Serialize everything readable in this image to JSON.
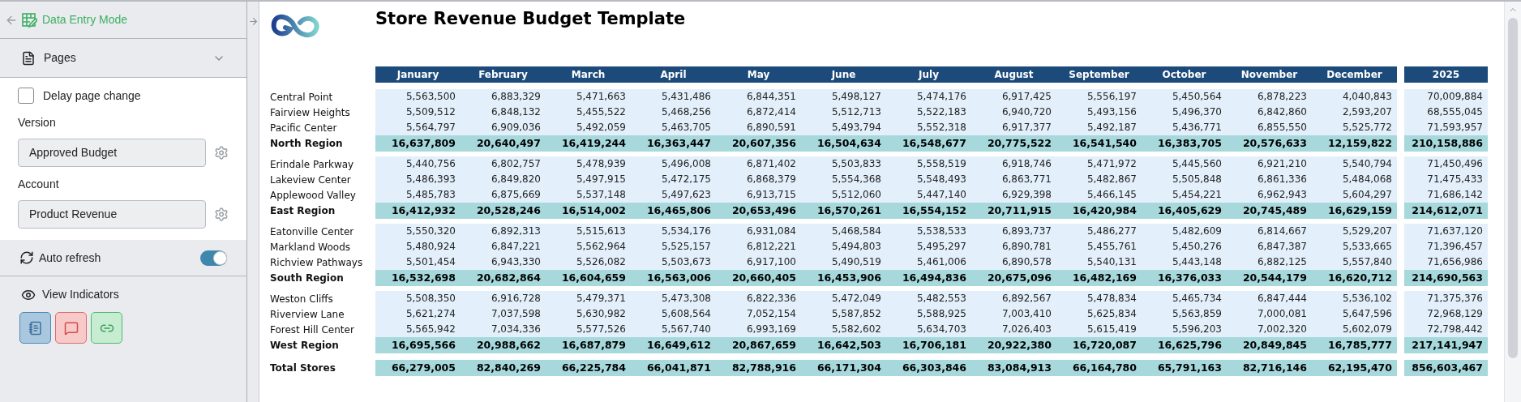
{
  "sidebar": {
    "mode": "Data Entry Mode",
    "pages": {
      "label": "Pages",
      "expanded": false
    },
    "delay": {
      "label": "Delay page change",
      "checked": false
    },
    "fields": [
      {
        "label": "Version",
        "value": "Approved Budget"
      },
      {
        "label": "Account",
        "value": "Product Revenue"
      }
    ],
    "auto_refresh": {
      "label": "Auto refresh",
      "on": true
    },
    "indicators": {
      "label": "View Indicators",
      "buttons": [
        {
          "kind": "notes"
        },
        {
          "kind": "comments"
        },
        {
          "kind": "links"
        }
      ]
    }
  },
  "report": {
    "title": "Store Revenue Budget Template",
    "columns": [
      "January",
      "February",
      "March",
      "April",
      "May",
      "June",
      "July",
      "August",
      "September",
      "October",
      "November",
      "December",
      "2025"
    ],
    "groups": [
      {
        "rows": [
          {
            "label": "Central Point",
            "cells": [
              "5,563,500",
              "6,883,329",
              "5,471,663",
              "5,431,486",
              "6,844,351",
              "5,498,127",
              "5,474,176",
              "6,917,425",
              "5,556,197",
              "5,450,564",
              "6,878,223",
              "4,040,843",
              "70,009,884"
            ]
          },
          {
            "label": "Fairview Heights",
            "cells": [
              "5,509,512",
              "6,848,132",
              "5,455,522",
              "5,468,256",
              "6,872,414",
              "5,512,713",
              "5,522,183",
              "6,940,720",
              "5,493,156",
              "5,496,370",
              "6,842,860",
              "2,593,207",
              "68,555,045"
            ]
          },
          {
            "label": "Pacific Center",
            "cells": [
              "5,564,797",
              "6,909,036",
              "5,492,059",
              "5,463,705",
              "6,890,591",
              "5,493,794",
              "5,552,318",
              "6,917,377",
              "5,492,187",
              "5,436,771",
              "6,855,550",
              "5,525,772",
              "71,593,957"
            ]
          }
        ],
        "subtotal": {
          "label": "North Region",
          "cells": [
            "16,637,809",
            "20,640,497",
            "16,419,244",
            "16,363,447",
            "20,607,356",
            "16,504,634",
            "16,548,677",
            "20,775,522",
            "16,541,540",
            "16,383,705",
            "20,576,633",
            "12,159,822",
            "210,158,886"
          ]
        }
      },
      {
        "rows": [
          {
            "label": "Erindale Parkway",
            "cells": [
              "5,440,756",
              "6,802,757",
              "5,478,939",
              "5,496,008",
              "6,871,402",
              "5,503,833",
              "5,558,519",
              "6,918,746",
              "5,471,972",
              "5,445,560",
              "6,921,210",
              "5,540,794",
              "71,450,496"
            ]
          },
          {
            "label": "Lakeview Center",
            "cells": [
              "5,486,393",
              "6,849,820",
              "5,497,915",
              "5,472,175",
              "6,868,379",
              "5,554,368",
              "5,548,493",
              "6,863,771",
              "5,482,867",
              "5,505,848",
              "6,861,336",
              "5,484,068",
              "71,475,433"
            ]
          },
          {
            "label": "Applewood Valley",
            "cells": [
              "5,485,783",
              "6,875,669",
              "5,537,148",
              "5,497,623",
              "6,913,715",
              "5,512,060",
              "5,447,140",
              "6,929,398",
              "5,466,145",
              "5,454,221",
              "6,962,943",
              "5,604,297",
              "71,686,142"
            ]
          }
        ],
        "subtotal": {
          "label": "East Region",
          "cells": [
            "16,412,932",
            "20,528,246",
            "16,514,002",
            "16,465,806",
            "20,653,496",
            "16,570,261",
            "16,554,152",
            "20,711,915",
            "16,420,984",
            "16,405,629",
            "20,745,489",
            "16,629,159",
            "214,612,071"
          ]
        }
      },
      {
        "rows": [
          {
            "label": "Eatonville Center",
            "cells": [
              "5,550,320",
              "6,892,313",
              "5,515,613",
              "5,534,176",
              "6,931,084",
              "5,468,584",
              "5,538,533",
              "6,893,737",
              "5,486,277",
              "5,482,609",
              "6,814,667",
              "5,529,207",
              "71,637,120"
            ]
          },
          {
            "label": "Markland Woods",
            "cells": [
              "5,480,924",
              "6,847,221",
              "5,562,964",
              "5,525,157",
              "6,812,221",
              "5,494,803",
              "5,495,297",
              "6,890,781",
              "5,455,761",
              "5,450,276",
              "6,847,387",
              "5,533,665",
              "71,396,457"
            ]
          },
          {
            "label": "Richview Pathways",
            "cells": [
              "5,501,454",
              "6,943,330",
              "5,526,082",
              "5,503,673",
              "6,917,100",
              "5,490,519",
              "5,461,006",
              "6,890,578",
              "5,540,131",
              "5,443,148",
              "6,882,125",
              "5,557,840",
              "71,656,986"
            ]
          }
        ],
        "subtotal": {
          "label": "South Region",
          "cells": [
            "16,532,698",
            "20,682,864",
            "16,604,659",
            "16,563,006",
            "20,660,405",
            "16,453,906",
            "16,494,836",
            "20,675,096",
            "16,482,169",
            "16,376,033",
            "20,544,179",
            "16,620,712",
            "214,690,563"
          ]
        }
      },
      {
        "rows": [
          {
            "label": "Weston Cliffs",
            "cells": [
              "5,508,350",
              "6,916,728",
              "5,479,371",
              "5,473,308",
              "6,822,336",
              "5,472,049",
              "5,482,553",
              "6,892,567",
              "5,478,834",
              "5,465,734",
              "6,847,444",
              "5,536,102",
              "71,375,376"
            ]
          },
          {
            "label": "Riverview Lane",
            "cells": [
              "5,621,274",
              "7,037,598",
              "5,630,982",
              "5,608,564",
              "7,052,154",
              "5,587,852",
              "5,588,925",
              "7,003,410",
              "5,625,834",
              "5,563,859",
              "7,000,081",
              "5,647,596",
              "72,968,129"
            ]
          },
          {
            "label": "Forest Hill Center",
            "cells": [
              "5,565,942",
              "7,034,336",
              "5,577,526",
              "5,567,740",
              "6,993,169",
              "5,582,602",
              "5,634,703",
              "7,026,403",
              "5,615,419",
              "5,596,203",
              "7,002,320",
              "5,602,079",
              "72,798,442"
            ]
          }
        ],
        "subtotal": {
          "label": "West Region",
          "cells": [
            "16,695,566",
            "20,988,662",
            "16,687,879",
            "16,649,612",
            "20,867,659",
            "16,642,503",
            "16,706,181",
            "20,922,380",
            "16,720,087",
            "16,625,796",
            "20,849,845",
            "16,785,777",
            "217,141,947"
          ]
        }
      }
    ],
    "grand_total": {
      "label": "Total Stores",
      "cells": [
        "66,279,005",
        "82,840,269",
        "66,225,784",
        "66,041,871",
        "82,788,916",
        "66,171,304",
        "66,303,846",
        "83,084,913",
        "66,164,780",
        "65,791,163",
        "82,716,146",
        "62,195,470",
        "856,603,467"
      ]
    }
  }
}
